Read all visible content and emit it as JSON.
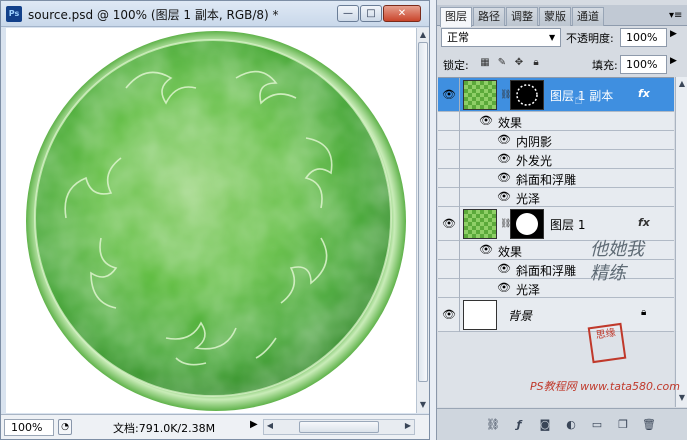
{
  "document": {
    "title": "source.psd @ 100% (图层 1 副本, RGB/8) *",
    "app_icon_label": "Ps",
    "zoom": "100%",
    "info": "文档:791.0K/2.38M"
  },
  "window_controls": {
    "minimize": "—",
    "maximize": "□",
    "close": "✕"
  },
  "panel": {
    "tabs": [
      "图层",
      "路径",
      "调整",
      "蒙版",
      "通道"
    ],
    "active_tab": 0,
    "blend_mode": "正常",
    "opacity_label": "不透明度:",
    "opacity_value": "100%",
    "lock_label": "锁定:",
    "fill_label": "填充:",
    "fill_value": "100%",
    "layers": [
      {
        "name": "图层 1 副本",
        "selected": true,
        "fx": "fx",
        "effects_label": "效果",
        "effects": [
          "内阴影",
          "外发光",
          "斜面和浮雕",
          "光泽"
        ]
      },
      {
        "name": "图层 1",
        "selected": false,
        "fx": "fx",
        "effects_label": "效果",
        "effects": [
          "斜面和浮雕",
          "光泽"
        ]
      },
      {
        "name": "背景",
        "selected": false,
        "locked": true
      }
    ]
  },
  "watermark": "PS教程网 www.tata580.com",
  "seal_text": "思缘",
  "signature": "他她我精练",
  "colors": {
    "accent": "#3f8fe0",
    "plate_green": "#3fae2c"
  }
}
